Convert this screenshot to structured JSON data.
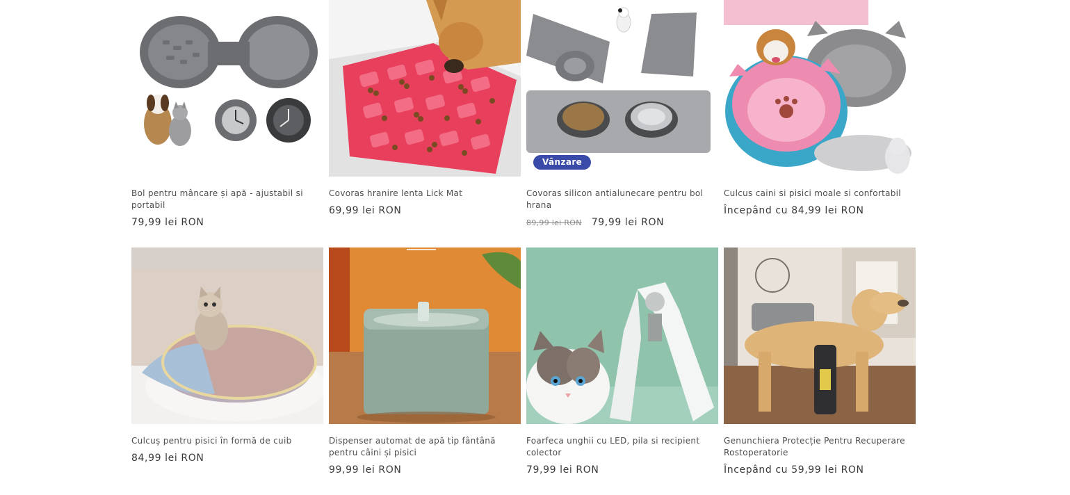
{
  "products": [
    {
      "title": "Bol pentru mâncare și apă - ajustabil si portabil",
      "price": "79,99 lei RON",
      "image": "collapsible-bowls-image"
    },
    {
      "title": "Covoras hranire lenta Lick Mat",
      "price": "69,99 lei RON",
      "image": "lick-mat-image"
    },
    {
      "title": "Covoras silicon antialunecare pentru bol hrana",
      "old_price": "89,99 lei RON",
      "price": "79,99 lei RON",
      "badge": "Vânzare",
      "image": "silicone-mat-image"
    },
    {
      "title": "Culcus caini si pisici moale si confortabil",
      "price": "Începând cu 84,99 lei RON",
      "image": "pet-bed-image"
    },
    {
      "title": "Culcuș pentru pisici în formă de cuib",
      "price": "84,99 lei RON",
      "image": "cat-nest-image"
    },
    {
      "title": "Dispenser automat de apă tip fântână pentru câini și pisici",
      "price": "99,99 lei RON",
      "image": "water-fountain-image"
    },
    {
      "title": "Foarfeca unghii cu LED, pila si recipient colector",
      "price": "79,99 lei RON",
      "image": "nail-clipper-image"
    },
    {
      "title": "Genunchiera Protecție Pentru Recuperare Rostoperatorie",
      "price": "Începând cu 59,99 lei RON",
      "image": "knee-brace-image"
    }
  ],
  "colors": {
    "badge": "#3a4aa8",
    "price_text": "#3a3a3a",
    "title_text": "#4d4d4d"
  }
}
